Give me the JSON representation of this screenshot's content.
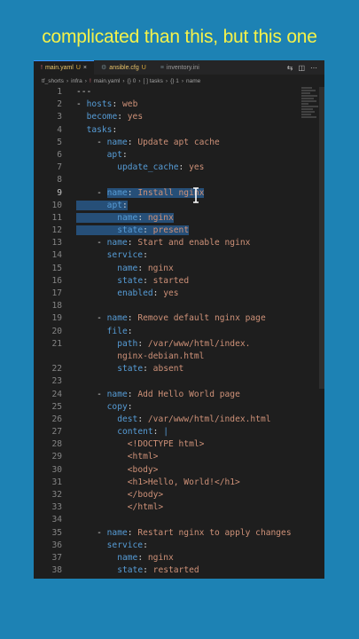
{
  "caption": "complicated than this, but this one",
  "tabs": [
    {
      "name": "main.yaml",
      "badge": "U",
      "active": true,
      "close": "×"
    },
    {
      "name": "ansible.cfg",
      "badge": "U",
      "active": false,
      "close": ""
    },
    {
      "name": "inventory.ini",
      "badge": "",
      "active": false,
      "close": ""
    }
  ],
  "breadcrumb": [
    "tf_shorts",
    "infra",
    "main.yaml",
    "{} 0",
    "[ ] tasks",
    "{} 1",
    "name"
  ],
  "lines": [
    {
      "n": "1",
      "t": [
        [
          "p",
          "---"
        ]
      ]
    },
    {
      "n": "2",
      "t": [
        [
          "p",
          "- "
        ],
        [
          "k",
          "hosts"
        ],
        [
          "p",
          ": "
        ],
        [
          "v",
          "web"
        ]
      ]
    },
    {
      "n": "3",
      "t": [
        [
          "p",
          "  "
        ],
        [
          "k",
          "become"
        ],
        [
          "p",
          ": "
        ],
        [
          "v",
          "yes"
        ]
      ]
    },
    {
      "n": "4",
      "t": [
        [
          "p",
          "  "
        ],
        [
          "k",
          "tasks"
        ],
        [
          "p",
          ":"
        ]
      ]
    },
    {
      "n": "5",
      "t": [
        [
          "p",
          "    - "
        ],
        [
          "k",
          "name"
        ],
        [
          "p",
          ": "
        ],
        [
          "v",
          "Update apt cache"
        ]
      ]
    },
    {
      "n": "6",
      "t": [
        [
          "p",
          "      "
        ],
        [
          "k",
          "apt"
        ],
        [
          "p",
          ":"
        ]
      ]
    },
    {
      "n": "7",
      "t": [
        [
          "p",
          "        "
        ],
        [
          "k",
          "update_cache"
        ],
        [
          "p",
          ": "
        ],
        [
          "v",
          "yes"
        ]
      ]
    },
    {
      "n": "8",
      "t": []
    },
    {
      "n": "9",
      "cur": true,
      "t": [
        [
          "p",
          "    - "
        ],
        [
          "k",
          "name",
          "sel"
        ],
        [
          "p",
          ": ",
          "sel"
        ],
        [
          "v",
          "Install nginx",
          "sel"
        ]
      ]
    },
    {
      "n": "10",
      "t": [
        [
          "p",
          "    ",
          "sel"
        ],
        [
          "p",
          "  ",
          "sel"
        ],
        [
          "k",
          "apt",
          "sel"
        ],
        [
          "p",
          ":",
          "sel"
        ]
      ]
    },
    {
      "n": "11",
      "t": [
        [
          "p",
          "    ",
          "sel"
        ],
        [
          "p",
          "    ",
          "sel"
        ],
        [
          "k",
          "name",
          "sel"
        ],
        [
          "p",
          ": ",
          "sel"
        ],
        [
          "v",
          "nginx",
          "sel"
        ]
      ]
    },
    {
      "n": "12",
      "t": [
        [
          "p",
          "    ",
          "sel"
        ],
        [
          "p",
          "    ",
          "sel"
        ],
        [
          "k",
          "state",
          "sel"
        ],
        [
          "p",
          ": ",
          "sel"
        ],
        [
          "v",
          "present",
          "sel"
        ]
      ]
    },
    {
      "n": "13",
      "t": [
        [
          "p",
          "    - "
        ],
        [
          "k",
          "name"
        ],
        [
          "p",
          ": "
        ],
        [
          "v",
          "Start and enable nginx"
        ]
      ]
    },
    {
      "n": "14",
      "t": [
        [
          "p",
          "      "
        ],
        [
          "k",
          "service"
        ],
        [
          "p",
          ":"
        ]
      ]
    },
    {
      "n": "15",
      "t": [
        [
          "p",
          "        "
        ],
        [
          "k",
          "name"
        ],
        [
          "p",
          ": "
        ],
        [
          "v",
          "nginx"
        ]
      ]
    },
    {
      "n": "16",
      "t": [
        [
          "p",
          "        "
        ],
        [
          "k",
          "state"
        ],
        [
          "p",
          ": "
        ],
        [
          "v",
          "started"
        ]
      ]
    },
    {
      "n": "17",
      "t": [
        [
          "p",
          "        "
        ],
        [
          "k",
          "enabled"
        ],
        [
          "p",
          ": "
        ],
        [
          "v",
          "yes"
        ]
      ]
    },
    {
      "n": "18",
      "t": []
    },
    {
      "n": "19",
      "t": [
        [
          "p",
          "    - "
        ],
        [
          "k",
          "name"
        ],
        [
          "p",
          ": "
        ],
        [
          "v",
          "Remove default nginx page"
        ]
      ]
    },
    {
      "n": "20",
      "t": [
        [
          "p",
          "      "
        ],
        [
          "k",
          "file"
        ],
        [
          "p",
          ":"
        ]
      ]
    },
    {
      "n": "21",
      "t": [
        [
          "p",
          "        "
        ],
        [
          "k",
          "path"
        ],
        [
          "p",
          ": "
        ],
        [
          "v",
          "/var/www/html/index."
        ]
      ]
    },
    {
      "n": "",
      "t": [
        [
          "p",
          "        "
        ],
        [
          "v",
          "nginx-debian.html"
        ]
      ]
    },
    {
      "n": "22",
      "t": [
        [
          "p",
          "        "
        ],
        [
          "k",
          "state"
        ],
        [
          "p",
          ": "
        ],
        [
          "v",
          "absent"
        ]
      ]
    },
    {
      "n": "23",
      "t": []
    },
    {
      "n": "24",
      "t": [
        [
          "p",
          "    - "
        ],
        [
          "k",
          "name"
        ],
        [
          "p",
          ": "
        ],
        [
          "v",
          "Add Hello World page"
        ]
      ]
    },
    {
      "n": "25",
      "t": [
        [
          "p",
          "      "
        ],
        [
          "k",
          "copy"
        ],
        [
          "p",
          ":"
        ]
      ]
    },
    {
      "n": "26",
      "t": [
        [
          "p",
          "        "
        ],
        [
          "k",
          "dest"
        ],
        [
          "p",
          ": "
        ],
        [
          "v",
          "/var/www/html/index.html"
        ]
      ]
    },
    {
      "n": "27",
      "t": [
        [
          "p",
          "        "
        ],
        [
          "k",
          "content"
        ],
        [
          "p",
          ": "
        ],
        [
          "k",
          "|"
        ]
      ]
    },
    {
      "n": "28",
      "t": [
        [
          "p",
          "          "
        ],
        [
          "v",
          "<!DOCTYPE html>"
        ]
      ]
    },
    {
      "n": "29",
      "t": [
        [
          "p",
          "          "
        ],
        [
          "v",
          "<html>"
        ]
      ]
    },
    {
      "n": "30",
      "t": [
        [
          "p",
          "          "
        ],
        [
          "v",
          "<body>"
        ]
      ]
    },
    {
      "n": "31",
      "t": [
        [
          "p",
          "          "
        ],
        [
          "v",
          "<h1>Hello, World!</h1>"
        ]
      ]
    },
    {
      "n": "32",
      "t": [
        [
          "p",
          "          "
        ],
        [
          "v",
          "</body>"
        ]
      ]
    },
    {
      "n": "33",
      "t": [
        [
          "p",
          "          "
        ],
        [
          "v",
          "</html>"
        ]
      ]
    },
    {
      "n": "34",
      "t": []
    },
    {
      "n": "35",
      "t": [
        [
          "p",
          "    - "
        ],
        [
          "k",
          "name"
        ],
        [
          "p",
          ": "
        ],
        [
          "v",
          "Restart nginx to apply changes"
        ]
      ]
    },
    {
      "n": "36",
      "t": [
        [
          "p",
          "      "
        ],
        [
          "k",
          "service"
        ],
        [
          "p",
          ":"
        ]
      ]
    },
    {
      "n": "37",
      "t": [
        [
          "p",
          "        "
        ],
        [
          "k",
          "name"
        ],
        [
          "p",
          ": "
        ],
        [
          "v",
          "nginx"
        ]
      ]
    },
    {
      "n": "38",
      "t": [
        [
          "p",
          "        "
        ],
        [
          "k",
          "state"
        ],
        [
          "p",
          ": "
        ],
        [
          "v",
          "restarted"
        ]
      ]
    }
  ],
  "icons": {
    "split": "split-editor-icon",
    "more": "more-actions-icon",
    "compare": "compare-icon"
  }
}
